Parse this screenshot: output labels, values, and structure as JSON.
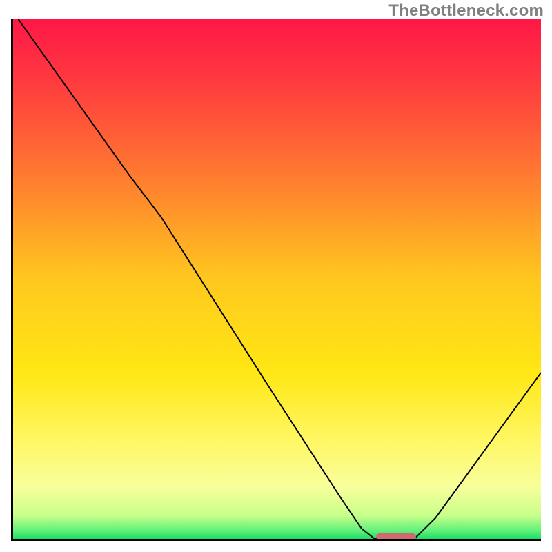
{
  "watermark": "TheBottleneck.com",
  "colors": {
    "axis": "#000000",
    "watermark": "#808080",
    "zone": "#cf6a6f",
    "gradient_stops": [
      {
        "offset": 0.0,
        "color": "#ff1747"
      },
      {
        "offset": 0.12,
        "color": "#ff3a3f"
      },
      {
        "offset": 0.3,
        "color": "#ff7a30"
      },
      {
        "offset": 0.5,
        "color": "#ffc81f"
      },
      {
        "offset": 0.68,
        "color": "#ffe714"
      },
      {
        "offset": 0.82,
        "color": "#fff86a"
      },
      {
        "offset": 0.9,
        "color": "#f8ff9c"
      },
      {
        "offset": 0.955,
        "color": "#c8ff8a"
      },
      {
        "offset": 0.985,
        "color": "#5ef07a"
      },
      {
        "offset": 1.0,
        "color": "#18e064"
      }
    ]
  },
  "chart_data": {
    "type": "line",
    "xlabel": "",
    "ylabel": "",
    "xlim": [
      0,
      100
    ],
    "ylim": [
      0,
      100
    ],
    "title": "",
    "series": [
      {
        "name": "bottleneck-curve",
        "points": [
          {
            "x": 1.0,
            "y": 100.0
          },
          {
            "x": 22.0,
            "y": 70.0
          },
          {
            "x": 28.0,
            "y": 62.0
          },
          {
            "x": 48.0,
            "y": 30.0
          },
          {
            "x": 62.0,
            "y": 8.0
          },
          {
            "x": 66.0,
            "y": 2.0
          },
          {
            "x": 68.5,
            "y": 0.0
          },
          {
            "x": 76.0,
            "y": 0.0
          },
          {
            "x": 80.0,
            "y": 4.0
          },
          {
            "x": 100.0,
            "y": 32.0
          }
        ]
      }
    ],
    "optimal_zone": {
      "x_start": 68.5,
      "x_end": 76.0
    }
  }
}
